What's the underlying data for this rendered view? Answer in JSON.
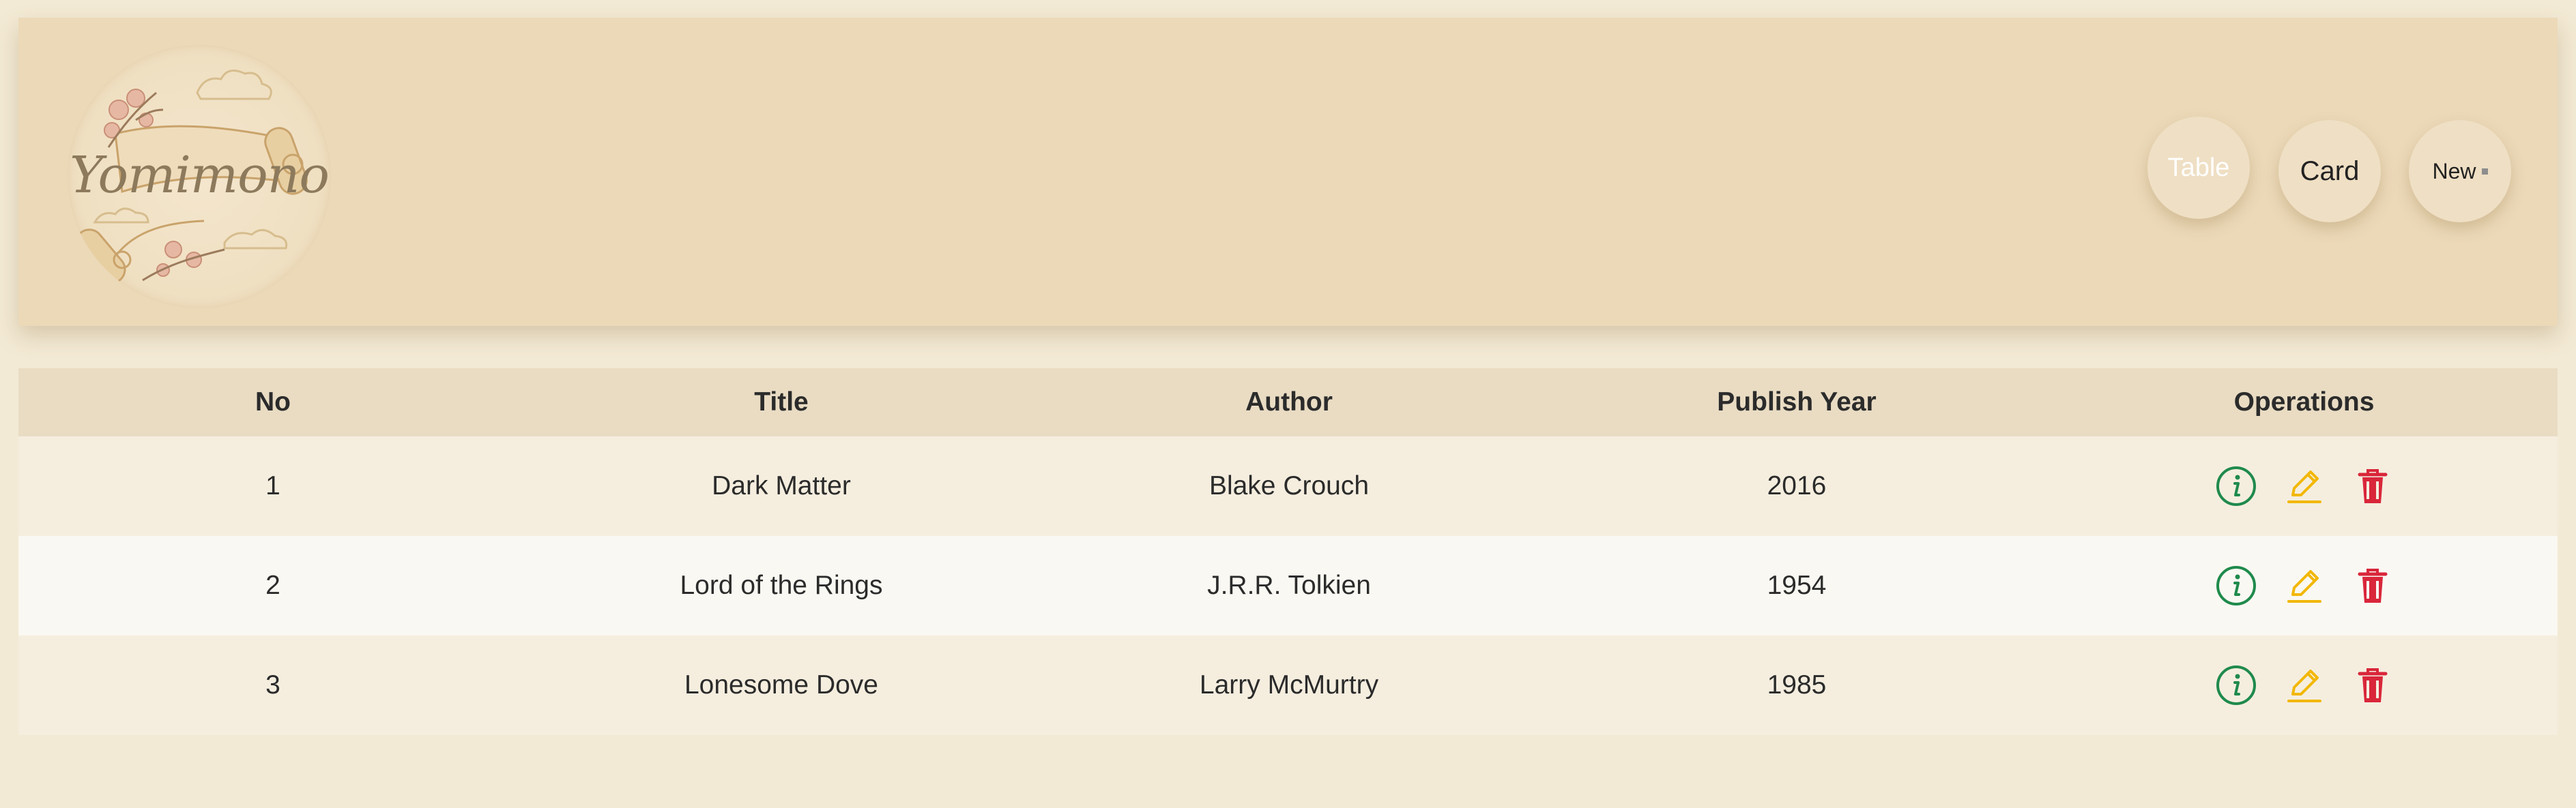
{
  "brand": {
    "logo_text": "Yomimono"
  },
  "view_buttons": {
    "table": "Table",
    "card": "Card",
    "new": "New"
  },
  "table": {
    "headers": [
      "No",
      "Title",
      "Author",
      "Publish Year",
      "Operations"
    ],
    "rows": [
      {
        "no": "1",
        "title": "Dark Matter",
        "author": "Blake Crouch",
        "year": "2016"
      },
      {
        "no": "2",
        "title": "Lord of the Rings",
        "author": "J.R.R. Tolkien",
        "year": "1954"
      },
      {
        "no": "3",
        "title": "Lonesome Dove",
        "author": "Larry McMurtry",
        "year": "1985"
      }
    ],
    "operation_icons": [
      "info-circle-icon",
      "pencil-edit-icon",
      "trash-icon"
    ]
  },
  "colors": {
    "info": "#1f8a4c",
    "edit": "#f2b705",
    "delete": "#d9263a",
    "header_bg": "#ecd9b8",
    "page_bg": "#f3ead5"
  }
}
